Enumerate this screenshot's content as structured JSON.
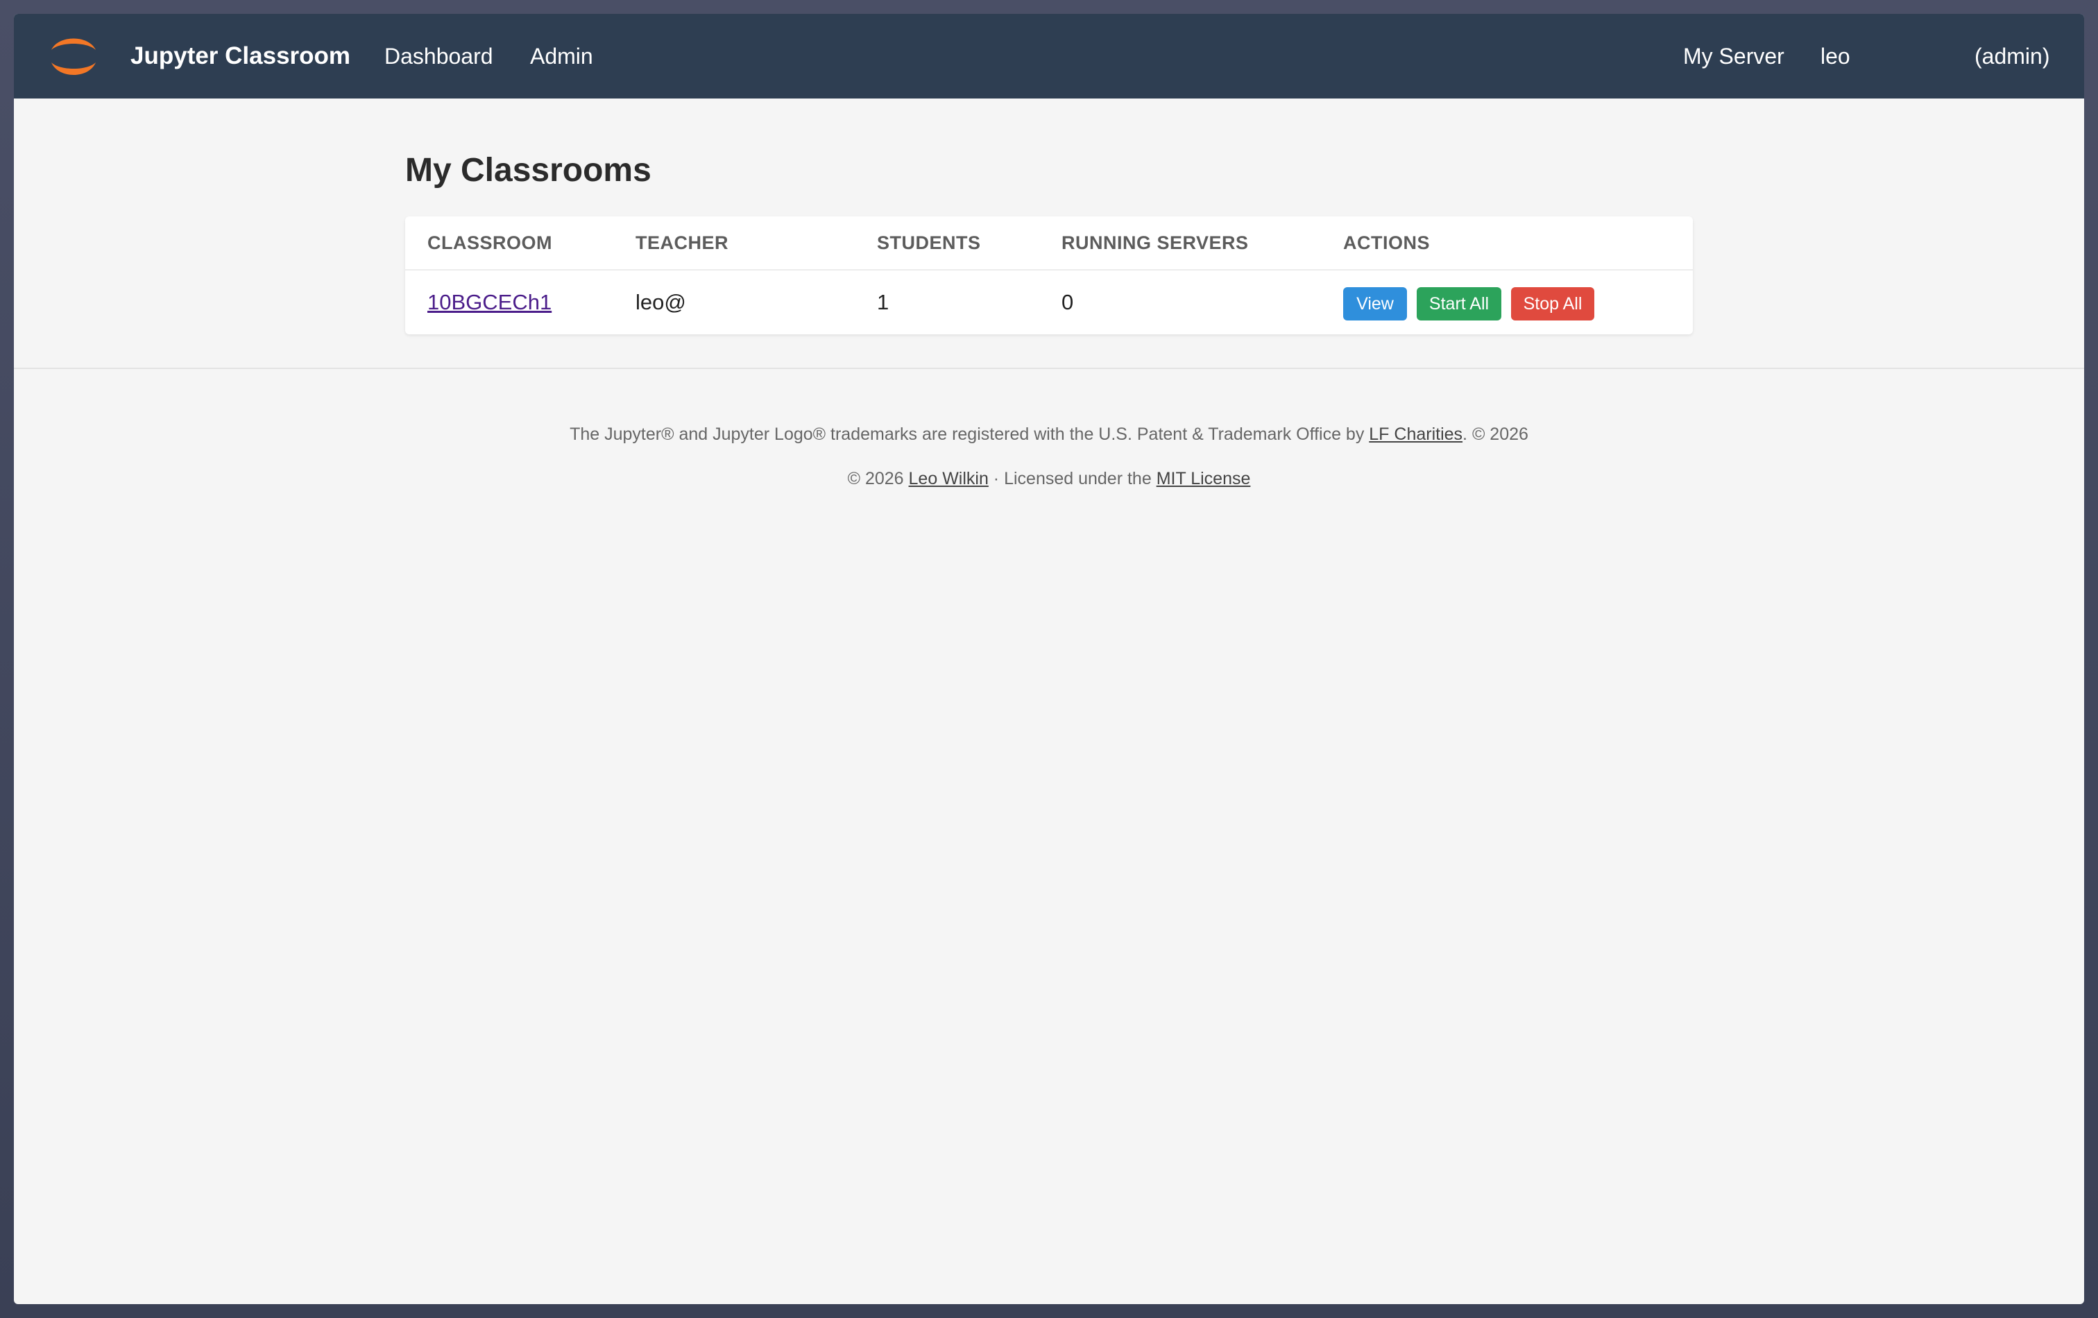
{
  "navbar": {
    "brand": "Jupyter Classroom",
    "links": {
      "dashboard": "Dashboard",
      "admin": "Admin"
    },
    "right": {
      "my_server": "My Server",
      "user": "leo",
      "role": "(admin)"
    }
  },
  "main": {
    "title": "My Classrooms",
    "table": {
      "headers": {
        "classroom": "CLASSROOM",
        "teacher": "TEACHER",
        "students": "STUDENTS",
        "running_servers": "RUNNING SERVERS",
        "actions": "ACTIONS"
      },
      "rows": [
        {
          "classroom": "10BGCECh1",
          "teacher": "leo@",
          "students": "1",
          "running_servers": "0",
          "actions": {
            "view": "View",
            "start_all": "Start All",
            "stop_all": "Stop All"
          }
        }
      ]
    }
  },
  "footer": {
    "line1_prefix": "The Jupyter® and Jupyter Logo® trademarks are registered with the U.S. Patent & Trademark Office by ",
    "line1_link": "LF Charities",
    "line1_suffix": ". © 2026",
    "line2_prefix": "© 2026 ",
    "line2_author": "Leo Wilkin",
    "line2_middle": " · Licensed under the ",
    "line2_license": "MIT License"
  },
  "colors": {
    "navbar_bg": "#2e3e52",
    "logo_orange": "#f37726",
    "view_button": "#2f8fdc",
    "start_button": "#2ca35b",
    "stop_button": "#e04a3e",
    "link_purple": "#4b1d8a"
  },
  "icons": {
    "logo": "jupyter-logo-icon"
  }
}
